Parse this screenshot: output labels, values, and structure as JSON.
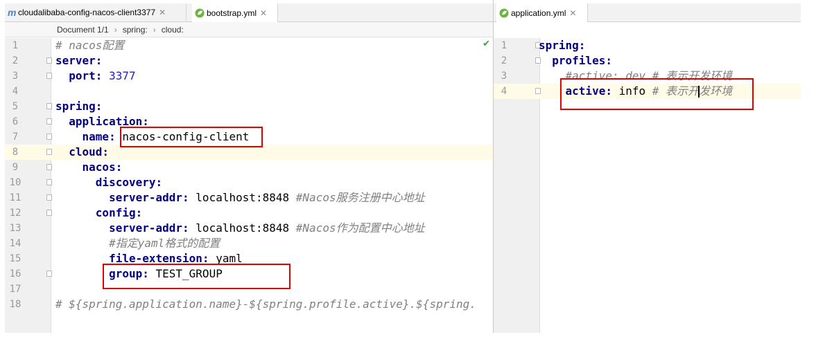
{
  "left_pane": {
    "tabs": [
      {
        "label": "cloudalibaba-config-nacos-client3377",
        "icon": "maven-module-icon"
      },
      {
        "label": "bootstrap.yml",
        "icon": "spring-yml-icon"
      }
    ],
    "breadcrumb": {
      "document": "Document 1/1",
      "items": [
        "spring:",
        "cloud:"
      ]
    },
    "line_numbers": [
      "1",
      "2",
      "3",
      "4",
      "5",
      "6",
      "7",
      "8",
      "9",
      "10",
      "11",
      "12",
      "13",
      "14",
      "15",
      "16",
      "17",
      "18"
    ],
    "lines": [
      {
        "comment": "# nacos配置"
      },
      {
        "key": "server:"
      },
      {
        "key": "port:",
        "value": "3377"
      },
      {},
      {
        "key": "spring:"
      },
      {
        "key": "application:"
      },
      {
        "key": "name:",
        "value": "nacos-config-client"
      },
      {
        "key": "cloud:"
      },
      {
        "key": "nacos:"
      },
      {
        "key": "discovery:"
      },
      {
        "key": "server-addr:",
        "value": "localhost:8848",
        "comment": "#Nacos服务注册中心地址"
      },
      {
        "key": "config:"
      },
      {
        "key": "server-addr:",
        "value": "localhost:8848",
        "comment": "#Nacos作为配置中心地址"
      },
      {
        "comment": "#指定yaml格式的配置"
      },
      {
        "key": "file-extension:",
        "value": "yaml"
      },
      {
        "key": "group:",
        "value": "TEST_GROUP"
      },
      {},
      {
        "comment": "# ${spring.application.name}-${spring.profile.active}.${spring."
      }
    ]
  },
  "right_pane": {
    "tabs": [
      {
        "label": "application.yml",
        "icon": "spring-yml-icon"
      }
    ],
    "line_numbers": [
      "1",
      "2",
      "3",
      "4"
    ],
    "lines": [
      {
        "key": "spring:"
      },
      {
        "key": "profiles:"
      },
      {
        "comment": "#active: dev # 表示开发环境"
      },
      {
        "key": "active:",
        "value": "info",
        "comment_a": "# 表示开",
        "comment_b": "发环境"
      }
    ]
  },
  "colors": {
    "key": "#000080",
    "value": "#1f1fbf",
    "comment": "#808080",
    "highlight": "#e00000",
    "current_line": "#fffbe6"
  }
}
